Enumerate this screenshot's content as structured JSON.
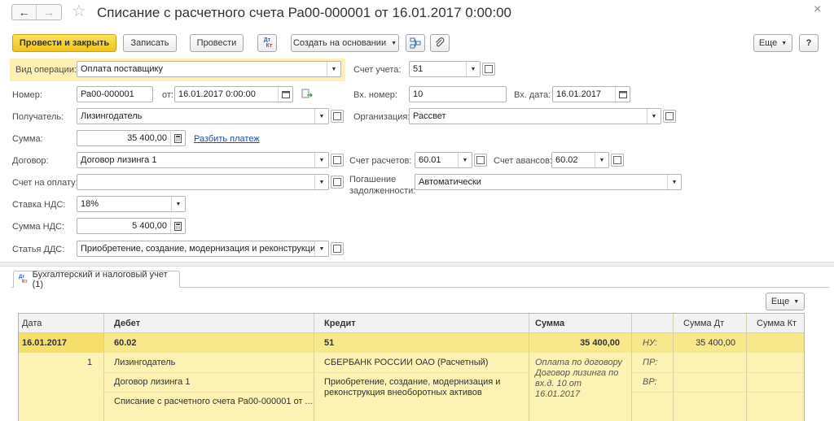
{
  "window": {
    "title": "Списание с расчетного счета Ра00-000001 от 16.01.2017 0:00:00",
    "close_glyph": "×"
  },
  "toolbar": {
    "post_close": "Провести и закрыть",
    "save": "Записать",
    "post": "Провести",
    "dtkt_top": "Дт",
    "dtkt_bottom": "Кт",
    "create_based": "Создать на основании",
    "more": "Еще",
    "help": "?"
  },
  "form": {
    "operation_label": "Вид операции:",
    "operation_value": "Оплата поставщику",
    "account_label": "Счет учета:",
    "account_value": "51",
    "number_label": "Номер:",
    "number_value": "Ра00-000001",
    "from_label": "от:",
    "date_value": "16.01.2017  0:00:00",
    "in_number_label": "Вх. номер:",
    "in_number_value": "10",
    "in_date_label": "Вх. дата:",
    "in_date_value": "16.01.2017",
    "recipient_label": "Получатель:",
    "recipient_value": "Лизингодатель",
    "org_label": "Организация:",
    "org_value": "Рассвет",
    "sum_label": "Сумма:",
    "sum_value": "35 400,00",
    "split_link": "Разбить платеж",
    "contract_label": "Договор:",
    "contract_value": "Договор лизинга 1",
    "settle_label": "Счет расчетов:",
    "settle_value": "60.01",
    "advance_label": "Счет авансов:",
    "advance_value": "60.02",
    "invoice_label": "Счет на оплату:",
    "invoice_value": "",
    "debt_label_1": "Погашение",
    "debt_label_2": "задолженности:",
    "debt_value": "Автоматически",
    "vat_rate_label": "Ставка НДС:",
    "vat_rate_value": "18%",
    "vat_sum_label": "Сумма НДС:",
    "vat_sum_value": "5 400,00",
    "dds_label": "Статья ДДС:",
    "dds_value": "Приобретение, создание, модернизация и реконструкция вн"
  },
  "tab": {
    "dt": "Дт",
    "kt": "Кт",
    "label": "Бухгалтерский и налоговый учет (1)",
    "more": "Еще"
  },
  "table": {
    "headers": {
      "date": "Дата",
      "debit": "Дебет",
      "credit": "Кредит",
      "sum": "Сумма",
      "sum_dt": "Сумма Дт",
      "sum_kt": "Сумма Кт"
    },
    "row": {
      "date": "16.01.2017",
      "num": "1",
      "debit_account": "60.02",
      "debit_sub1": "Лизингодатель",
      "debit_sub2": "Договор лизинга 1",
      "debit_sub3": "Списание с расчетного счета Ра00-000001 от ...",
      "credit_account": "51",
      "credit_sub1": "СБЕРБАНК РОССИИ ОАО (Расчетный)",
      "credit_sub2_l1": "Приобретение, создание, модернизация и",
      "credit_sub2_l2": "реконструкция внеоборотных активов",
      "sum": "35 400,00",
      "desc_1": "Оплата по договору",
      "desc_2": "Договор лизинга по",
      "desc_3": "вх.д. 10 от",
      "desc_4": "16.01.2017",
      "nu": "НУ:",
      "pr": "ПР:",
      "vr": "ВР:",
      "sum_dt": "35 400,00",
      "sum_kt": ""
    }
  },
  "colors": {
    "primary_button": "#f5d033",
    "highlight_row": "#fbf2b4",
    "selected_row": "#f5df6a",
    "link": "#1f4ea8"
  }
}
